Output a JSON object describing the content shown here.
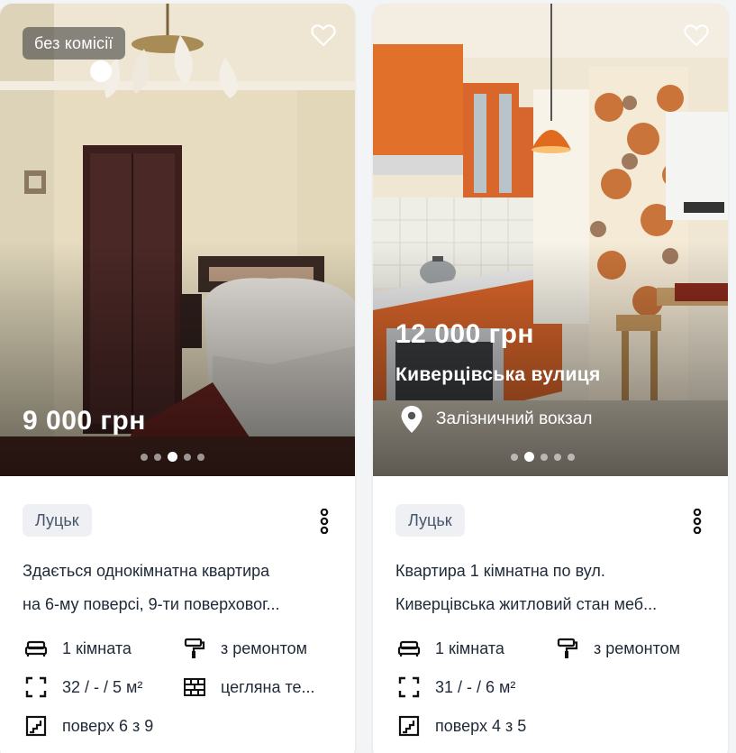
{
  "listings": [
    {
      "badge": "без комісії",
      "price": "9 000 грн",
      "street": "",
      "station": "",
      "photo_dots": {
        "count": 5,
        "active_index": 2
      },
      "city": "Луцьк",
      "description_lines": [
        "Здається однокімнатна квартира",
        "на 6-му поверсі, 9-ти поверховог..."
      ],
      "features": {
        "rooms": "1 кімната",
        "repair": "з ремонтом",
        "area": "32 / - / 5 м²",
        "wall": "цегляна те...",
        "floor": "поверх 6 з 9"
      }
    },
    {
      "badge": "",
      "price": "12 000 грн",
      "street": "Киверцівська вулиця",
      "station": "Залізничний вокзал",
      "photo_dots": {
        "count": 5,
        "active_index": 1
      },
      "city": "Луцьк",
      "description_lines": [
        "Квартира 1 кімнатна по вул.",
        "Киверцівська житловий стан меб..."
      ],
      "features": {
        "rooms": "1 кімната",
        "repair": "з ремонтом",
        "area": "31 / - / 6 м²",
        "wall": "",
        "floor": "поверх 4 з 5"
      }
    }
  ],
  "icons": {
    "favorite": "heart-outline-icon",
    "more": "vertical-dots-icon",
    "rooms": "bed-icon",
    "repair": "paint-roller-icon",
    "area": "area-frame-icon",
    "wall": "brick-wall-icon",
    "floor": "stairs-icon",
    "station": "map-pin-icon"
  },
  "colors": {
    "card_bg": "#ffffff",
    "page_bg": "#f3f4f6",
    "chip_bg": "#eef0f4",
    "text": "#1f2937"
  }
}
